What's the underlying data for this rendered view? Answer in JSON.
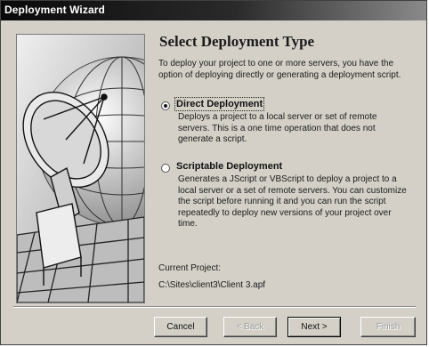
{
  "window": {
    "title": "Deployment Wizard"
  },
  "page": {
    "heading": "Select Deployment Type",
    "intro": "To deploy your project to one or more servers, you have the option of deploying directly or generating a deployment script."
  },
  "options": [
    {
      "label": "Direct Deployment",
      "description": "Deploys a project to a local server or set of remote servers. This is a one time operation that does not generate a script.",
      "selected": true
    },
    {
      "label": "Scriptable Deployment",
      "description": "Generates a JScript or VBScript to deploy a project to a local server or a set of remote servers. You can customize the script before running it and you can run the script repeatedly to deploy new versions of your project over time.",
      "selected": false
    }
  ],
  "current_project": {
    "label": "Current Project:",
    "path": "C:\\Sites\\client3\\Client 3.apf"
  },
  "buttons": {
    "cancel": "Cancel",
    "back": "< Back",
    "next": "Next >",
    "finish": "Finish"
  },
  "illustration": {
    "icon": "satellite-dish-icon"
  }
}
